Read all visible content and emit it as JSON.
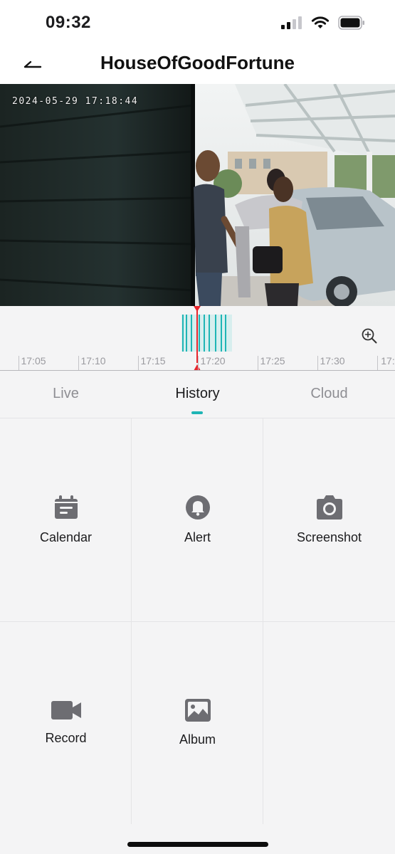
{
  "status_bar": {
    "time": "09:32"
  },
  "nav": {
    "title": "HouseOfGoodFortune",
    "back_icon": "back-arrow-icon"
  },
  "camera": {
    "timestamp": "2024-05-29 17:18:44"
  },
  "timeline": {
    "ticks": [
      "17:05",
      "17:10",
      "17:15",
      "17:20",
      "17:25",
      "17:30",
      "17:"
    ],
    "accent_color": "#1fb5b5",
    "playhead_color": "#e8262d"
  },
  "tabs": [
    {
      "label": "Live"
    },
    {
      "label": "History"
    },
    {
      "label": "Cloud"
    }
  ],
  "active_tab": "History",
  "actions": [
    {
      "label": "Calendar",
      "icon": "calendar-icon"
    },
    {
      "label": "Alert",
      "icon": "bell-icon"
    },
    {
      "label": "Screenshot",
      "icon": "camera-icon"
    },
    {
      "label": "Record",
      "icon": "video-camera-icon"
    },
    {
      "label": "Album",
      "icon": "image-icon"
    }
  ]
}
